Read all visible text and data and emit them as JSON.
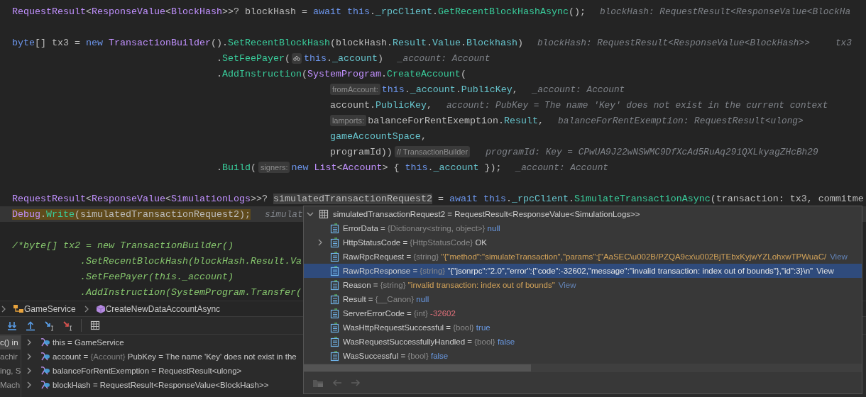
{
  "editor": {
    "lines": [
      {
        "current": false,
        "parts": [
          {
            "kind": "code",
            "tokens": [
              {
                "text": "RequestResult",
                "kind": "type"
              },
              {
                "text": "<",
                "kind": "plain"
              },
              {
                "text": "ResponseValue",
                "kind": "type"
              },
              {
                "text": "<",
                "kind": "plain"
              },
              {
                "text": "BlockHash",
                "kind": "type"
              },
              {
                "text": ">>? blockHash = ",
                "kind": "plain"
              },
              {
                "text": "await ",
                "kind": "kw"
              },
              {
                "text": "this",
                "kind": "kw"
              },
              {
                "text": ".",
                "kind": "plain"
              },
              {
                "text": "_rpcClient",
                "kind": "member"
              },
              {
                "text": ".",
                "kind": "plain"
              },
              {
                "text": "GetRecentBlockHashAsync",
                "kind": "method"
              },
              {
                "text": "();",
                "kind": "plain"
              }
            ]
          },
          {
            "kind": "value",
            "text": "blockHash: RequestResult<ResponseValue<BlockHa"
          }
        ]
      },
      {
        "current": false
      },
      {
        "current": false,
        "parts": [
          {
            "kind": "code",
            "tokens": [
              {
                "text": "byte",
                "kind": "kw"
              },
              {
                "text": "[] tx3 = ",
                "kind": "plain"
              },
              {
                "text": "new ",
                "kind": "kw"
              },
              {
                "text": "TransactionBuilder",
                "kind": "type"
              },
              {
                "text": "().",
                "kind": "plain"
              },
              {
                "text": "SetRecentBlockHash",
                "kind": "method"
              },
              {
                "text": "(blockHash.",
                "kind": "plain"
              },
              {
                "text": "Result",
                "kind": "member"
              },
              {
                "text": ".",
                "kind": "plain"
              },
              {
                "text": "Value",
                "kind": "member"
              },
              {
                "text": ".",
                "kind": "plain"
              },
              {
                "text": "Blockhash",
                "kind": "member"
              },
              {
                "text": ")",
                "kind": "plain"
              }
            ]
          },
          {
            "kind": "value",
            "text": "blockHash: RequestResult<ResponseValue<BlockHash>>"
          },
          {
            "kind": "value",
            "text": "tx3"
          }
        ],
        "children": [
          {
            "current": false,
            "parts": [
              {
                "kind": "code",
                "tokens": [
                  {
                    "text": ".",
                    "kind": "plain"
                  },
                  {
                    "text": "SetFeePayer",
                    "kind": "method"
                  },
                  {
                    "text": "(",
                    "kind": "plain"
                  }
                ]
              },
              {
                "kind": "icon-hint"
              },
              {
                "kind": "code",
                "tokens": [
                  {
                    "text": "this",
                    "kind": "kw"
                  },
                  {
                    "text": ".",
                    "kind": "plain"
                  },
                  {
                    "text": "_account",
                    "kind": "member"
                  },
                  {
                    "text": ")",
                    "kind": "plain"
                  }
                ]
              },
              {
                "kind": "value",
                "text": "_account: Account"
              }
            ]
          },
          {
            "current": false,
            "parts": [
              {
                "kind": "code",
                "tokens": [
                  {
                    "text": ".",
                    "kind": "plain"
                  },
                  {
                    "text": "AddInstruction",
                    "kind": "method"
                  },
                  {
                    "text": "(",
                    "kind": "plain"
                  },
                  {
                    "text": "SystemProgram",
                    "kind": "type"
                  },
                  {
                    "text": ".",
                    "kind": "plain"
                  },
                  {
                    "text": "CreateAccount",
                    "kind": "method"
                  },
                  {
                    "text": "(",
                    "kind": "plain"
                  }
                ]
              }
            ],
            "children": [
              {
                "current": false,
                "parts": [
                  {
                    "kind": "hint",
                    "text": "fromAccount:"
                  },
                  {
                    "kind": "code",
                    "tokens": [
                      {
                        "text": "this",
                        "kind": "kw"
                      },
                      {
                        "text": ".",
                        "kind": "plain"
                      },
                      {
                        "text": "_account",
                        "kind": "member"
                      },
                      {
                        "text": ".",
                        "kind": "plain"
                      },
                      {
                        "text": "PublicKey",
                        "kind": "member"
                      },
                      {
                        "text": ",",
                        "kind": "plain"
                      }
                    ]
                  },
                  {
                    "kind": "value",
                    "text": "_account: Account"
                  }
                ]
              },
              {
                "current": false,
                "parts": [
                  {
                    "kind": "code",
                    "tokens": [
                      {
                        "text": "account.",
                        "kind": "plain"
                      },
                      {
                        "text": "PublicKey",
                        "kind": "member"
                      },
                      {
                        "text": ",",
                        "kind": "plain"
                      }
                    ]
                  },
                  {
                    "kind": "value",
                    "text": "account: PubKey = The name 'Key' does not exist in the current context"
                  }
                ]
              },
              {
                "current": false,
                "parts": [
                  {
                    "kind": "hint",
                    "text": "lamports:"
                  },
                  {
                    "kind": "code",
                    "tokens": [
                      {
                        "text": "balanceForRentExemption.",
                        "kind": "plain"
                      },
                      {
                        "text": "Result",
                        "kind": "member"
                      },
                      {
                        "text": ",",
                        "kind": "plain"
                      }
                    ]
                  },
                  {
                    "kind": "value",
                    "text": "balanceForRentExemption: RequestResult<ulong>"
                  }
                ]
              },
              {
                "current": false,
                "parts": [
                  {
                    "kind": "code",
                    "tokens": [
                      {
                        "text": "gameAccountSpace",
                        "kind": "member"
                      },
                      {
                        "text": ",",
                        "kind": "plain"
                      }
                    ]
                  }
                ]
              },
              {
                "current": false,
                "parts": [
                  {
                    "kind": "code",
                    "tokens": [
                      {
                        "text": "programId))",
                        "kind": "plain"
                      }
                    ]
                  },
                  {
                    "kind": "hint",
                    "text": "// TransactionBuilder"
                  },
                  {
                    "kind": "value",
                    "text": "programId: Key = CPwUA9J22wNSWMC9DfXcAd5RuAq291QXLkyagZHcBh29"
                  }
                ]
              }
            ]
          },
          {
            "current": false,
            "parts": [
              {
                "kind": "code",
                "tokens": [
                  {
                    "text": ".",
                    "kind": "plain"
                  },
                  {
                    "text": "Build",
                    "kind": "method"
                  },
                  {
                    "text": "(",
                    "kind": "plain"
                  }
                ]
              },
              {
                "kind": "hint",
                "text": "signers:"
              },
              {
                "kind": "code",
                "tokens": [
                  {
                    "text": "new ",
                    "kind": "kw"
                  },
                  {
                    "text": "List",
                    "kind": "type"
                  },
                  {
                    "text": "<",
                    "kind": "plain"
                  },
                  {
                    "text": "Account",
                    "kind": "type"
                  },
                  {
                    "text": "> { ",
                    "kind": "plain"
                  },
                  {
                    "text": "this",
                    "kind": "kw"
                  },
                  {
                    "text": ".",
                    "kind": "plain"
                  },
                  {
                    "text": "_account",
                    "kind": "member"
                  },
                  {
                    "text": " });",
                    "kind": "plain"
                  }
                ]
              },
              {
                "kind": "value",
                "text": "_account: Account"
              }
            ]
          }
        ]
      },
      {
        "current": false
      },
      {
        "current": false,
        "parts": [
          {
            "kind": "code",
            "tokens": [
              {
                "text": "RequestResult",
                "kind": "type"
              },
              {
                "text": "<",
                "kind": "plain"
              },
              {
                "text": "ResponseValue",
                "kind": "type"
              },
              {
                "text": "<",
                "kind": "plain"
              },
              {
                "text": "SimulationLogs",
                "kind": "type"
              },
              {
                "text": ">>? ",
                "kind": "plain"
              },
              {
                "text": "simulatedTransactionRequest2",
                "kind": "target"
              },
              {
                "text": " = ",
                "kind": "plain"
              },
              {
                "text": "await ",
                "kind": "kw"
              },
              {
                "text": "this",
                "kind": "kw"
              },
              {
                "text": ".",
                "kind": "plain"
              },
              {
                "text": "_rpcClient",
                "kind": "member"
              },
              {
                "text": ".",
                "kind": "plain"
              },
              {
                "text": "SimulateTransactionAsync",
                "kind": "method"
              },
              {
                "text": "(transaction: tx3, commitme",
                "kind": "plain"
              }
            ]
          }
        ]
      },
      {
        "current": true,
        "parts": [
          {
            "kind": "code",
            "tokens": [
              {
                "text": "Debug",
                "kind": "type"
              },
              {
                "text": ".",
                "kind": "plain"
              },
              {
                "text": "Write",
                "kind": "method"
              },
              {
                "text": "(simulatedTransactionRequest2);",
                "kind": "plain"
              }
            ]
          },
          {
            "kind": "value",
            "text": "simulat"
          }
        ]
      },
      {
        "current": false
      },
      {
        "current": false,
        "parts": [
          {
            "kind": "code",
            "tokens": [
              {
                "text": "/*byte[] tx2 = new TransactionBuilder()",
                "kind": "comment"
              }
            ]
          }
        ],
        "children": [
          {
            "current": false,
            "parts": [
              {
                "kind": "code",
                "tokens": [
                  {
                    "text": ".SetRecentBlockHash(blockHash.Result.Va",
                    "kind": "comment"
                  }
                ]
              }
            ]
          },
          {
            "current": false,
            "parts": [
              {
                "kind": "code",
                "tokens": [
                  {
                    "text": ".SetFeePayer(this._account)",
                    "kind": "comment"
                  }
                ]
              }
            ]
          },
          {
            "current": false,
            "parts": [
              {
                "kind": "code",
                "tokens": [
                  {
                    "text": ".AddInstruction(SystemProgram.Transfer(",
                    "kind": "comment"
                  }
                ]
              }
            ]
          }
        ]
      }
    ]
  },
  "breadcrumb": [
    {
      "kind": "class",
      "text": "GameService"
    },
    {
      "kind": "method",
      "text": "CreateNewDataAccountAsync"
    }
  ],
  "frames": [
    {
      "text": "c() in",
      "selected": true
    },
    {
      "text": "achir",
      "selected": false
    },
    {
      "text": "ing, S",
      "selected": false
    },
    {
      "text": "Mach",
      "selected": false
    }
  ],
  "variables": [
    {
      "name": "this =",
      "value": "GameService"
    },
    {
      "name": "account =",
      "type": "{Account}",
      "value": "PubKey = The name 'Key' does not exist in the"
    },
    {
      "name": "balanceForRentExemption =",
      "value": "RequestResult<ulong>"
    },
    {
      "name": "blockHash =",
      "value": "RequestResult<ResponseValue<BlockHash>>"
    }
  ],
  "popup": {
    "expanded": true,
    "title": "simulatedTransactionRequest2 = RequestResult<ResponseValue<SimulationLogs>>",
    "rows": [
      {
        "name": "ErrorData =",
        "type": "{Dictionary<string, object>}",
        "value": "null",
        "kind": "keyword",
        "expandable": false,
        "selected": false
      },
      {
        "name": "HttpStatusCode =",
        "type": "{HttpStatusCode}",
        "value": "OK",
        "kind": "plain",
        "expandable": true,
        "selected": false
      },
      {
        "name": "RawRpcRequest =",
        "type": "{string}",
        "value": "\"{\"method\":\"simulateTransaction\",\"params\":[\"AaSEC\\u002B/PZQA9cx\\u002BjTEbxKyjwYZLohxwTPWuaC/",
        "kind": "string",
        "view": "View",
        "expandable": false,
        "selected": false
      },
      {
        "name": "RawRpcResponse =",
        "type": "{string}",
        "value": "\"{\"jsonrpc\":\"2.0\",\"error\":{\"code\":-32602,\"message\":\"invalid transaction: index out of bounds\"},\"id\":3}\\n\"",
        "kind": "string",
        "view": "View",
        "expandable": false,
        "selected": true
      },
      {
        "name": "Reason =",
        "type": "{string}",
        "value": "\"invalid transaction: index out of bounds\"",
        "kind": "string",
        "view": "View",
        "expandable": false,
        "selected": false
      },
      {
        "name": "Result =",
        "type": "{__Canon}",
        "value": "null",
        "kind": "keyword",
        "expandable": false,
        "selected": false
      },
      {
        "name": "ServerErrorCode =",
        "type": "{int}",
        "value": "-32602",
        "kind": "number",
        "expandable": false,
        "selected": false
      },
      {
        "name": "WasHttpRequestSuccessful =",
        "type": "{bool}",
        "value": "true",
        "kind": "keyword",
        "expandable": false,
        "selected": false
      },
      {
        "name": "WasRequestSuccessfullyHandled =",
        "type": "{bool}",
        "value": "false",
        "kind": "keyword",
        "expandable": false,
        "selected": false
      },
      {
        "name": "WasSuccessful =",
        "type": "{bool}",
        "value": "false",
        "kind": "keyword",
        "expandable": false,
        "selected": false
      }
    ]
  }
}
